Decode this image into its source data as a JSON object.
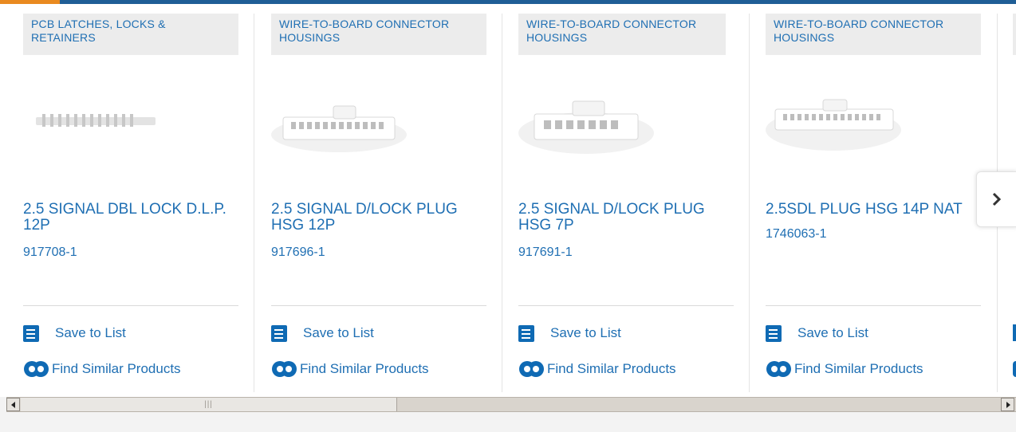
{
  "colors": {
    "brand_blue": "#1f6fb3",
    "top_bar": "#1f5e96",
    "accent_orange": "#e98a20",
    "category_bg": "#ececec"
  },
  "products": [
    {
      "category": "PCB LATCHES, LOCKS & RETAINERS",
      "title": "2.5 SIGNAL DBL LOCK D.L.P. 12P",
      "part_number": "917708-1",
      "image": "connector-latch-image"
    },
    {
      "category": "WIRE-TO-BOARD CONNECTOR HOUSINGS",
      "title": "2.5 SIGNAL D/LOCK PLUG HSG 12P",
      "part_number": "917696-1",
      "image": "connector-housing-image"
    },
    {
      "category": "WIRE-TO-BOARD CONNECTOR HOUSINGS",
      "title": "2.5 SIGNAL D/LOCK PLUG HSG 7P",
      "part_number": "917691-1",
      "image": "connector-housing-image"
    },
    {
      "category": "WIRE-TO-BOARD CONNECTOR HOUSINGS",
      "title": "2.5SDL PLUG HSG 14P NAT",
      "part_number": "1746063-1",
      "image": "connector-housing-image"
    }
  ],
  "actions": {
    "save_label": "Save to List",
    "save_icon": "checklist-icon",
    "find_label": "Find Similar Products",
    "find_icon": "gears-icon"
  },
  "carousel": {
    "next_icon": "chevron-right-icon"
  },
  "scrollbar": {
    "left_icon": "scroll-left-arrow-icon",
    "right_icon": "scroll-right-arrow-icon",
    "grip_icon": "grip-icon"
  }
}
